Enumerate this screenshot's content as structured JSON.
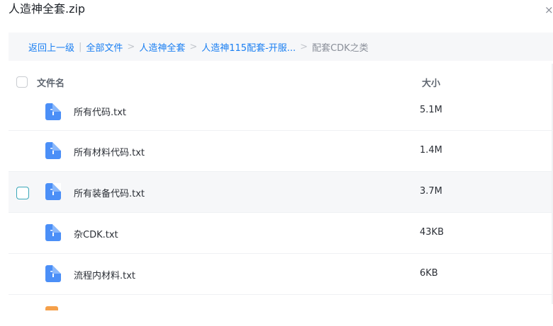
{
  "window": {
    "title": "人造神全套.zip",
    "close_glyph": "×"
  },
  "breadcrumb": {
    "items": [
      "返回上一级",
      "全部文件",
      "人造神全套",
      "人造神115配套-开服..."
    ],
    "current": "配套CDK之类",
    "divider": "|",
    "separator": ">"
  },
  "table": {
    "columns": {
      "name": "文件名",
      "size": "大小"
    },
    "rows": [
      {
        "name": "所有代码.txt",
        "size": "5.1M",
        "icon": "txt-file-icon"
      },
      {
        "name": "所有材料代码.txt",
        "size": "1.4M",
        "icon": "txt-file-icon"
      },
      {
        "name": "所有装备代码.txt",
        "size": "3.7M",
        "icon": "txt-file-icon"
      },
      {
        "name": "杂CDK.txt",
        "size": "43KB",
        "icon": "txt-file-icon"
      },
      {
        "name": "流程内材料.txt",
        "size": "6KB",
        "icon": "txt-file-icon"
      }
    ],
    "icon_glyph": "T"
  },
  "colors": {
    "accent": "#1a7ff2",
    "file_icon": "#4b8ff7",
    "hover_row": "#f6f7f9"
  }
}
